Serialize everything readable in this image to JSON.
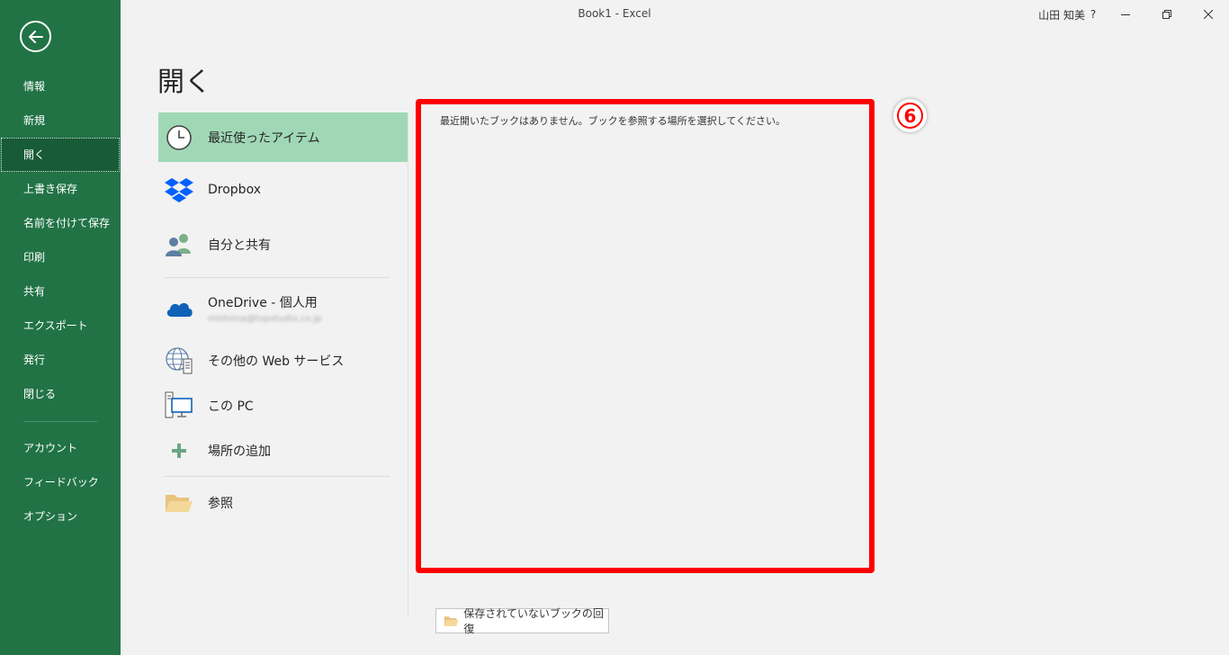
{
  "window": {
    "title": "Book1  -  Excel",
    "user_name": "山田 知美",
    "help_label": "?"
  },
  "sidebar": {
    "items": [
      {
        "label": "情報"
      },
      {
        "label": "新規"
      },
      {
        "label": "開く"
      },
      {
        "label": "上書き保存"
      },
      {
        "label": "名前を付けて保存"
      },
      {
        "label": "印刷"
      },
      {
        "label": "共有"
      },
      {
        "label": "エクスポート"
      },
      {
        "label": "発行"
      },
      {
        "label": "閉じる"
      }
    ],
    "bottom_items": [
      {
        "label": "アカウント"
      },
      {
        "label": "フィードバック"
      },
      {
        "label": "オプション"
      }
    ],
    "active_index": 2
  },
  "page_title": "開く",
  "locations": {
    "recent": "最近使ったアイテム",
    "dropbox": "Dropbox",
    "shared": "自分と共有",
    "onedrive": "OneDrive - 個人用",
    "onedrive_email": "mishima@topstudio.co.jp",
    "web_services": "その他の Web サービス",
    "this_pc": "この PC",
    "add_place": "場所の追加",
    "browse": "参照"
  },
  "recent": {
    "empty_message": "最近開いたブックはありません。ブックを参照する場所を選択してください。"
  },
  "annotation": {
    "step": "6"
  },
  "recover_button": {
    "label": "保存されていないブックの回復"
  },
  "colors": {
    "sidebar": "#217346",
    "sidebar_active": "#185c37",
    "selected_location": "#a0d8b6",
    "highlight_box": "#ff0000"
  }
}
